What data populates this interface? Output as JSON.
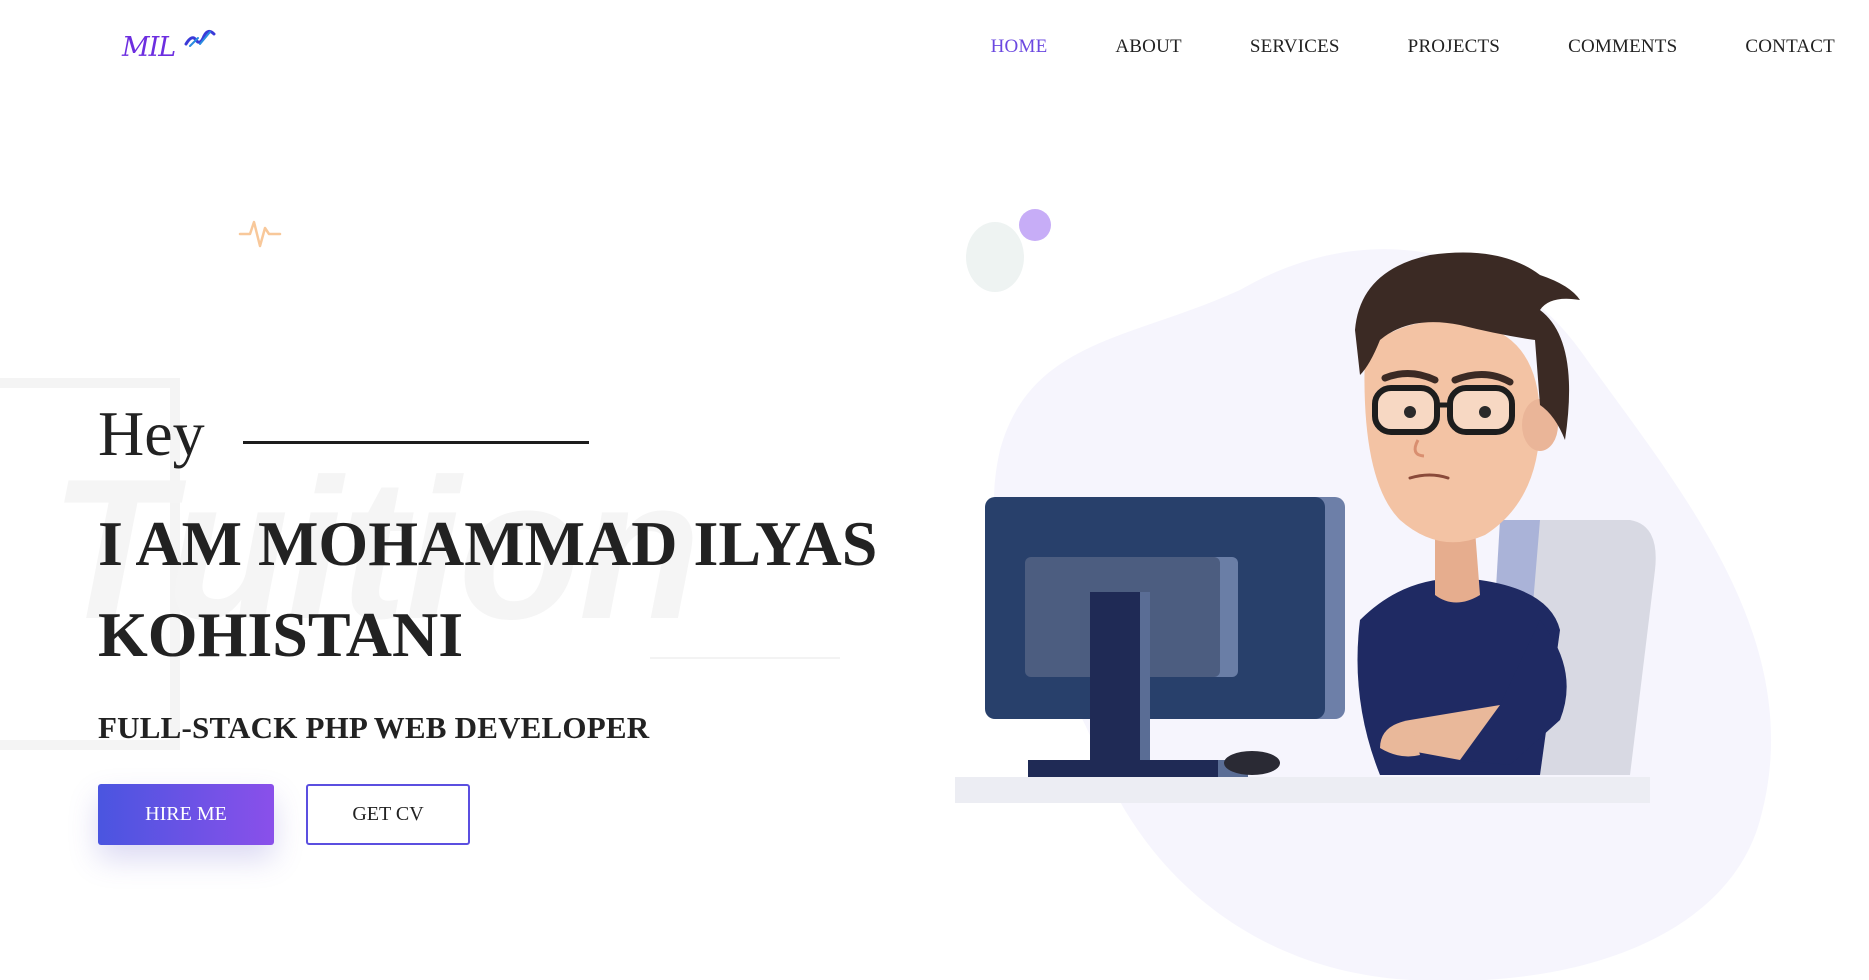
{
  "header": {
    "logo_text": "MIL",
    "nav": [
      {
        "label": "HOME",
        "active": true
      },
      {
        "label": "ABOUT",
        "active": false
      },
      {
        "label": "SERVICES",
        "active": false
      },
      {
        "label": "PROJECTS",
        "active": false
      },
      {
        "label": "COMMENTS",
        "active": false
      },
      {
        "label": "CONTACT",
        "active": false
      }
    ]
  },
  "hero": {
    "greeting": "Hey",
    "name_line1": "I AM MOHAMMAD ILYAS",
    "name_line2": "KOHISTANI",
    "role": "FULL-STACK PHP WEB DEVELOPER",
    "hire_label": "HIRE ME",
    "cv_label": "GET CV",
    "watermark_text": "Tuition"
  },
  "colors": {
    "accent": "#6b48e0",
    "button_gradient_start": "#4a55e0",
    "button_gradient_end": "#8a50ea",
    "text": "#222222"
  },
  "icons": {
    "logo_mark": "brush-logo-icon",
    "decor": "heartbeat-pulse-icon",
    "illustration": "developer-at-computer-illustration"
  }
}
